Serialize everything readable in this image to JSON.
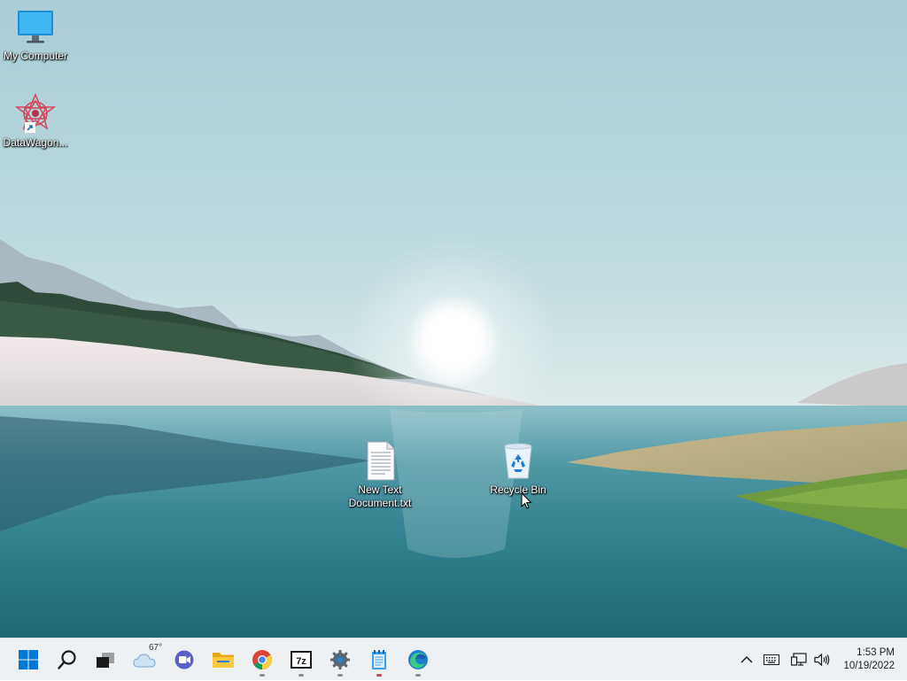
{
  "desktop": {
    "icons": [
      {
        "name": "my-computer",
        "label": "My Computer",
        "icon": "monitor-icon"
      },
      {
        "name": "datawagon",
        "label": "DataWagon...",
        "icon": "datawagon-app-icon"
      },
      {
        "name": "new-text-document",
        "label": "New Text\nDocument.txt",
        "icon": "text-file-icon"
      },
      {
        "name": "recycle-bin",
        "label": "Recycle Bin",
        "icon": "recycle-bin-icon"
      }
    ]
  },
  "taskbar": {
    "weather_temp": "67°",
    "items": [
      {
        "name": "start",
        "icon": "windows-start-icon"
      },
      {
        "name": "search",
        "icon": "search-icon"
      },
      {
        "name": "task-view",
        "icon": "task-view-icon"
      },
      {
        "name": "weather",
        "icon": "weather-cloud-icon"
      },
      {
        "name": "chat",
        "icon": "chat-icon"
      },
      {
        "name": "file-explorer",
        "icon": "folder-icon"
      },
      {
        "name": "chrome",
        "icon": "chrome-icon"
      },
      {
        "name": "7zip",
        "icon": "7zip-icon"
      },
      {
        "name": "settings",
        "icon": "gear-icon"
      },
      {
        "name": "notepad",
        "icon": "notepad-icon"
      },
      {
        "name": "edge",
        "icon": "edge-icon"
      }
    ]
  },
  "tray": {
    "icons": [
      "chevron-up-icon",
      "keyboard-icon",
      "network-icon",
      "volume-icon"
    ]
  },
  "clock": {
    "time": "1:53 PM",
    "date": "10/19/2022"
  },
  "colors": {
    "taskbar_bg": "#eef1f4",
    "windows_blue": "#0078d4",
    "running_indicator": "#8a8f95"
  }
}
